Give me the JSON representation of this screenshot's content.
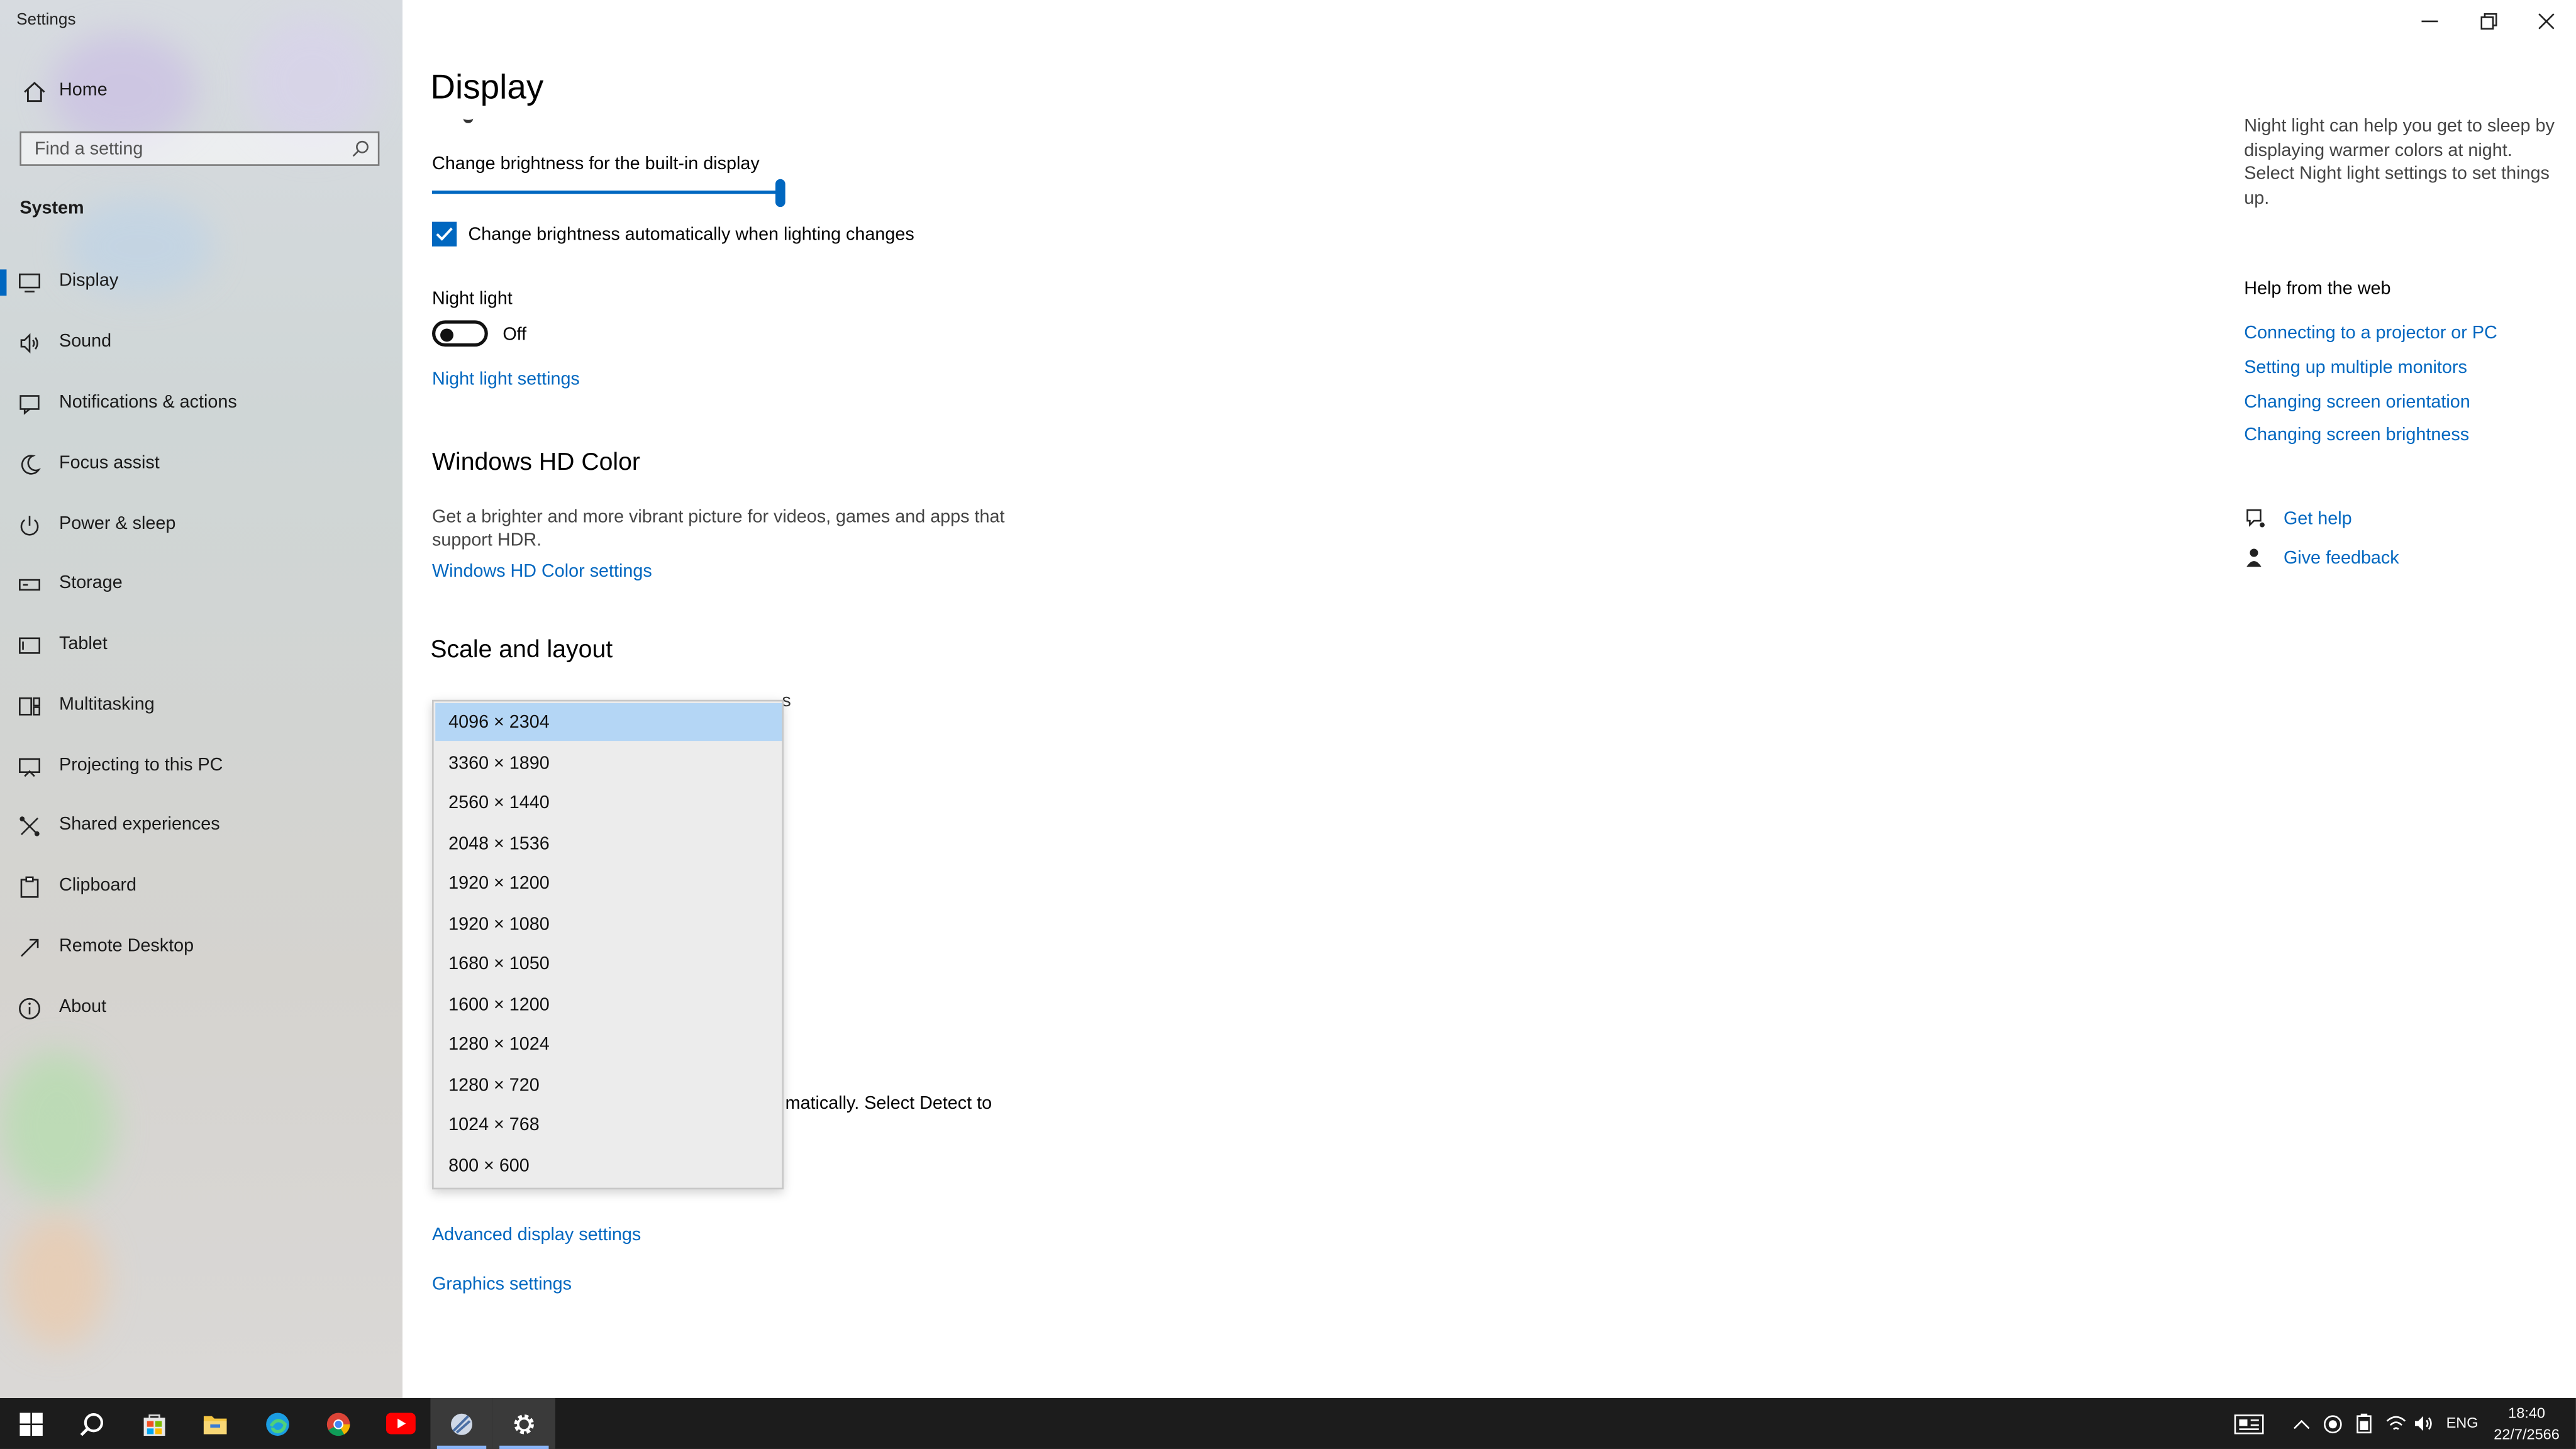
{
  "window": {
    "title": "Settings"
  },
  "sidebar": {
    "home_label": "Home",
    "search_placeholder": "Find a setting",
    "section_heading": "System",
    "items": [
      {
        "label": "Display",
        "icon": "monitor-icon",
        "active": true
      },
      {
        "label": "Sound",
        "icon": "speaker-icon"
      },
      {
        "label": "Notifications & actions",
        "icon": "notification-icon"
      },
      {
        "label": "Focus assist",
        "icon": "moon-icon"
      },
      {
        "label": "Power & sleep",
        "icon": "power-icon"
      },
      {
        "label": "Storage",
        "icon": "drive-icon"
      },
      {
        "label": "Tablet",
        "icon": "tablet-icon"
      },
      {
        "label": "Multitasking",
        "icon": "multitasking-icon"
      },
      {
        "label": "Projecting to this PC",
        "icon": "projecting-icon"
      },
      {
        "label": "Shared experiences",
        "icon": "shared-icon"
      },
      {
        "label": "Clipboard",
        "icon": "clipboard-icon"
      },
      {
        "label": "Remote Desktop",
        "icon": "remote-icon"
      },
      {
        "label": "About",
        "icon": "info-icon"
      }
    ]
  },
  "main": {
    "title": "Display",
    "brightness_label": "Change brightness for the built-in display",
    "brightness_value": 1.0,
    "auto_brightness_label": "Change brightness automatically when lighting changes",
    "auto_brightness_checked": true,
    "night_light_label": "Night light",
    "night_light_state": "Off",
    "night_light_settings_link": "Night light settings",
    "hd_color_heading": "Windows HD Color",
    "hd_color_desc": "Get a brighter and more vibrant picture for videos, games and apps that support HDR.",
    "hd_color_link": "Windows HD Color settings",
    "scale_heading": "Scale and layout",
    "hidden_fragment_1": "s",
    "hidden_fragment_2": "matically. Select Detect to",
    "advanced_link": "Advanced display settings",
    "graphics_link": "Graphics settings"
  },
  "resolution_dropdown": {
    "selected": "4096 × 2304",
    "options": [
      "4096 × 2304",
      "3360 × 1890",
      "2560 × 1440",
      "2048 × 1536",
      "1920 × 1200",
      "1920 × 1080",
      "1680 × 1050",
      "1600 × 1200",
      "1280 × 1024",
      "1280 × 720",
      "1024 × 768",
      "800 × 600"
    ]
  },
  "right_panel": {
    "night_light_info": "Night light can help you get to sleep by displaying warmer colors at night. Select Night light settings to set things up.",
    "help_heading": "Help from the web",
    "help_links": [
      "Connecting to a projector or PC",
      "Setting up multiple monitors",
      "Changing screen orientation",
      "Changing screen brightness"
    ],
    "get_help": "Get help",
    "give_feedback": "Give feedback"
  },
  "taskbar": {
    "apps": [
      "start-icon",
      "search-icon",
      "store-icon",
      "file-explorer-icon",
      "edge-icon",
      "chrome-icon",
      "youtube-icon",
      "app-icon",
      "settings-icon"
    ],
    "language": "ENG",
    "time": "18:40",
    "date": "22/7/2566"
  },
  "colors": {
    "accent": "#0067c0",
    "selection": "#b4d6f5",
    "taskbar": "#1c1c1c"
  }
}
